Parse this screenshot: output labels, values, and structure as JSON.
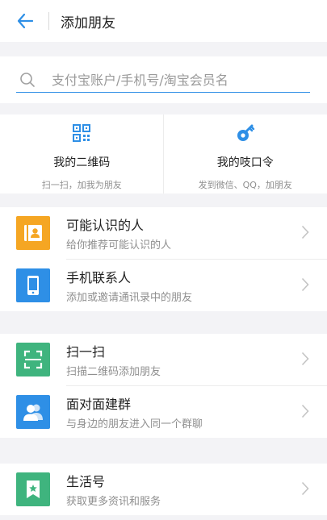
{
  "header": {
    "title": "添加朋友"
  },
  "search": {
    "placeholder": "支付宝账户/手机号/淘宝会员名"
  },
  "quick": [
    {
      "title": "我的二维码",
      "subtitle": "扫一扫，加我为朋友",
      "icon": "qr-code-icon"
    },
    {
      "title": "我的吱口令",
      "subtitle": "发到微信、QQ，加朋友",
      "icon": "whistle-key-icon"
    }
  ],
  "groups": [
    {
      "items": [
        {
          "title": "可能认识的人",
          "subtitle": "给你推荐可能认识的人",
          "icon": "contact-card-icon",
          "color": "#f5a623"
        },
        {
          "title": "手机联系人",
          "subtitle": "添加或邀请通讯录中的朋友",
          "icon": "phone-icon",
          "color": "#2e8fe6"
        }
      ]
    },
    {
      "items": [
        {
          "title": "扫一扫",
          "subtitle": "扫描二维码添加朋友",
          "icon": "scan-icon",
          "color": "#3fb47e"
        },
        {
          "title": "面对面建群",
          "subtitle": "与身边的朋友进入同一个群聊",
          "icon": "group-people-icon",
          "color": "#2e8fe6"
        }
      ]
    },
    {
      "items": [
        {
          "title": "生活号",
          "subtitle": "获取更多资讯和服务",
          "icon": "bookmark-star-icon",
          "color": "#3fb47e"
        }
      ]
    }
  ],
  "colors": {
    "accent": "#2e8fe6",
    "orange": "#f5a623",
    "green": "#3fb47e",
    "background": "#f3f3f6"
  }
}
